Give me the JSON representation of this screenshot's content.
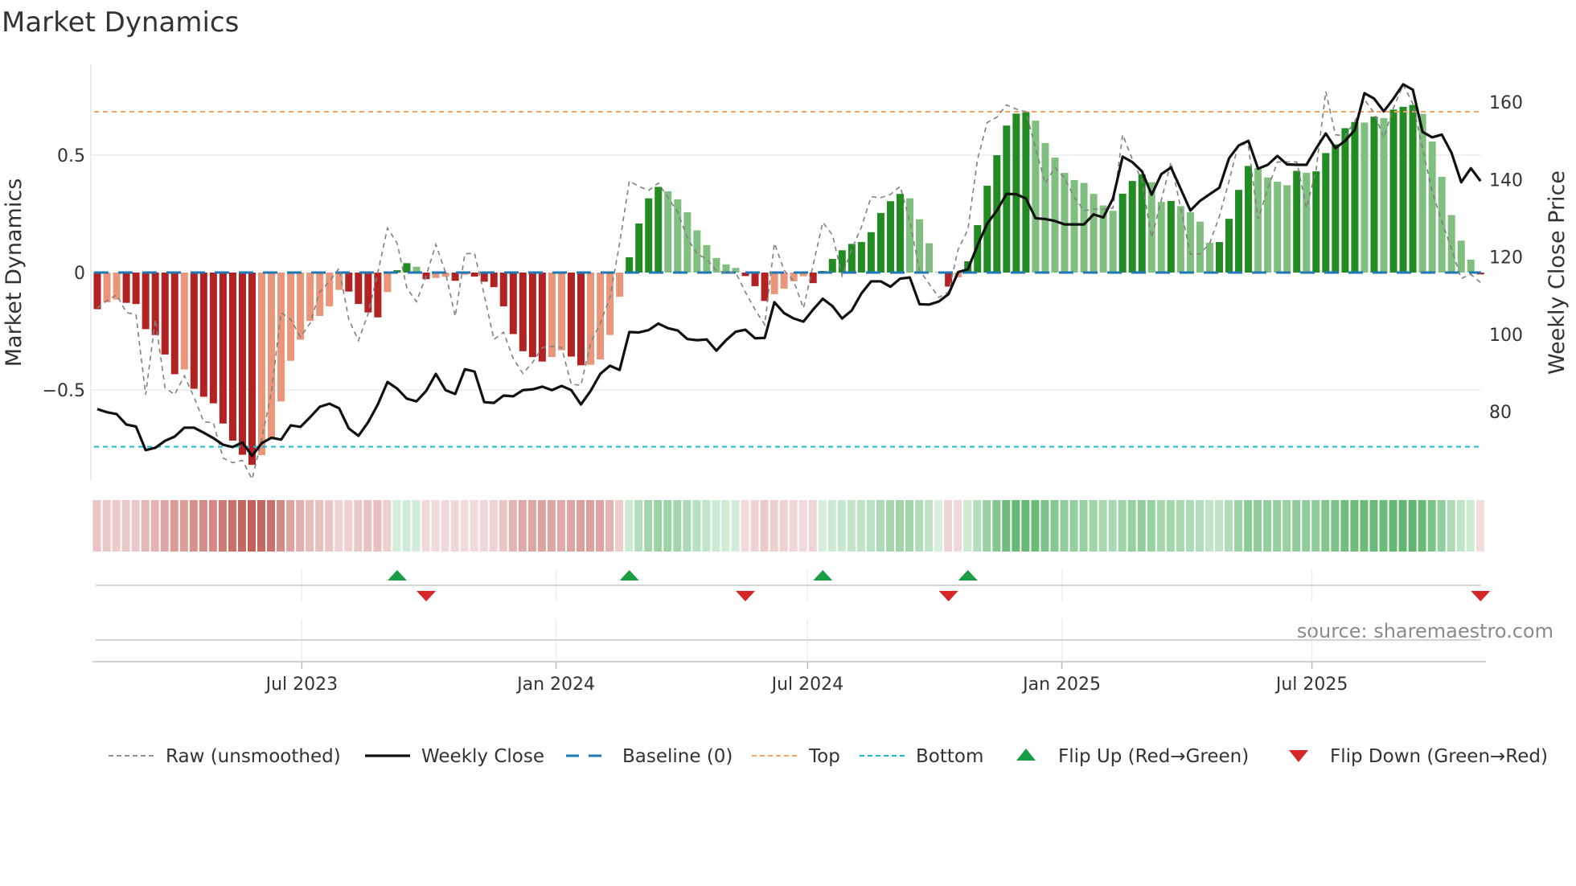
{
  "chart_data": {
    "type": "bar",
    "title": "Market Dynamics",
    "ylabel": "Market Dynamics",
    "y2label": "Weekly Close Price",
    "ylim": [
      -0.88,
      0.88
    ],
    "y2lim": [
      63,
      169
    ],
    "yticks": [
      {
        "v": 0.5,
        "label": "0.5"
      },
      {
        "v": 0,
        "label": "0"
      },
      {
        "v": -0.5,
        "label": "−0.5"
      }
    ],
    "y2ticks": [
      {
        "v": 160,
        "label": "160"
      },
      {
        "v": 140,
        "label": "140"
      },
      {
        "v": 120,
        "label": "120"
      },
      {
        "v": 100,
        "label": "100"
      },
      {
        "v": 80,
        "label": "80"
      }
    ],
    "xticks": [
      {
        "date": "2023-07-01",
        "label": "Jul 2023"
      },
      {
        "date": "2024-01-01",
        "label": "Jan 2024"
      },
      {
        "date": "2024-07-01",
        "label": "Jul 2024"
      },
      {
        "date": "2025-01-01",
        "label": "Jan 2025"
      },
      {
        "date": "2025-07-01",
        "label": "Jul 2025"
      }
    ],
    "first_week": "2023-02-03",
    "frequency": "weekly",
    "top_level": 0.685,
    "bottom_level": -0.742,
    "baseline": 0,
    "grid": true,
    "legend_position": "bottom",
    "series": [
      {
        "name": "Market Dynamics (smoothed)",
        "values": [
          -0.156,
          -0.127,
          -0.115,
          -0.129,
          -0.134,
          -0.241,
          -0.266,
          -0.349,
          -0.433,
          -0.413,
          -0.495,
          -0.529,
          -0.557,
          -0.643,
          -0.716,
          -0.776,
          -0.819,
          -0.778,
          -0.707,
          -0.549,
          -0.376,
          -0.286,
          -0.206,
          -0.185,
          -0.144,
          -0.074,
          -0.081,
          -0.134,
          -0.17,
          -0.191,
          -0.083,
          0.01,
          0.04,
          0.025,
          -0.028,
          -0.023,
          -0.018,
          -0.035,
          -0.009,
          -0.017,
          -0.039,
          -0.062,
          -0.144,
          -0.262,
          -0.335,
          -0.36,
          -0.379,
          -0.36,
          -0.331,
          -0.358,
          -0.395,
          -0.393,
          -0.37,
          -0.266,
          -0.103,
          0.065,
          0.209,
          0.316,
          0.365,
          0.346,
          0.312,
          0.257,
          0.18,
          0.117,
          0.062,
          0.035,
          0.02,
          -0.015,
          -0.058,
          -0.121,
          -0.092,
          -0.069,
          -0.037,
          -0.016,
          -0.045,
          0.007,
          0.058,
          0.095,
          0.122,
          0.13,
          0.172,
          0.254,
          0.304,
          0.335,
          0.316,
          0.227,
          0.125,
          0.003,
          -0.06,
          -0.02,
          0.048,
          0.202,
          0.37,
          0.5,
          0.626,
          0.677,
          0.684,
          0.647,
          0.552,
          0.49,
          0.425,
          0.394,
          0.382,
          0.335,
          0.286,
          0.263,
          0.336,
          0.39,
          0.419,
          0.385,
          0.301,
          0.305,
          0.283,
          0.257,
          0.217,
          0.127,
          0.13,
          0.229,
          0.352,
          0.454,
          0.445,
          0.405,
          0.387,
          0.372,
          0.433,
          0.425,
          0.431,
          0.509,
          0.546,
          0.615,
          0.641,
          0.639,
          0.664,
          0.658,
          0.694,
          0.706,
          0.714,
          0.676,
          0.558,
          0.408,
          0.245,
          0.136,
          0.055,
          -0.008
        ]
      },
      {
        "name": "Raw (unsmoothed)",
        "values": [
          -0.15,
          -0.12,
          -0.095,
          -0.17,
          -0.18,
          -0.52,
          -0.2,
          -0.49,
          -0.52,
          -0.44,
          -0.53,
          -0.635,
          -0.64,
          -0.79,
          -0.81,
          -0.8,
          -0.88,
          -0.71,
          -0.51,
          -0.17,
          -0.2,
          -0.274,
          -0.216,
          -0.083,
          -0.037,
          0.018,
          -0.2,
          -0.29,
          -0.175,
          0.0,
          0.19,
          0.125,
          -0.066,
          -0.124,
          -0.014,
          0.12,
          0.0,
          -0.187,
          0.08,
          0.082,
          -0.095,
          -0.285,
          -0.254,
          -0.366,
          -0.43,
          -0.383,
          -0.32,
          -0.314,
          -0.32,
          -0.476,
          -0.48,
          -0.3,
          -0.216,
          -0.106,
          0.125,
          0.39,
          0.367,
          0.35,
          0.381,
          0.32,
          0.257,
          0.148,
          0.079,
          0.058,
          0.009,
          0.0,
          0.0,
          -0.083,
          -0.158,
          -0.222,
          0.125,
          0.01,
          -0.037,
          -0.152,
          0.032,
          0.214,
          0.16,
          -0.014,
          0.1,
          0.194,
          0.323,
          0.319,
          0.333,
          0.367,
          0.217,
          0.01,
          -0.048,
          -0.106,
          -0.083,
          0.1,
          0.182,
          0.483,
          0.639,
          0.662,
          0.714,
          0.696,
          0.685,
          0.529,
          0.379,
          0.448,
          0.402,
          0.321,
          0.263,
          0.27,
          0.27,
          0.275,
          0.587,
          0.483,
          0.39,
          0.148,
          0.309,
          0.471,
          0.275,
          0.079,
          0.079,
          0.125,
          0.24,
          0.39,
          0.552,
          0.54,
          0.228,
          0.356,
          0.471,
          0.471,
          0.471,
          0.275,
          0.437,
          0.771,
          0.587,
          0.582,
          0.644,
          0.737,
          0.679,
          0.575,
          0.702,
          0.8,
          0.72,
          0.529,
          0.344,
          0.217,
          0.1,
          -0.025,
          -0.008,
          -0.043
        ]
      },
      {
        "name": "Weekly Close",
        "axis": "right",
        "values": [
          80.7,
          79.9,
          79.4,
          76.7,
          76.2,
          70.1,
          70.7,
          72.5,
          73.6,
          75.9,
          75.9,
          74.6,
          73.2,
          71.5,
          70.9,
          72.1,
          68.6,
          71.9,
          73.3,
          72.8,
          76.5,
          76.1,
          78.6,
          81.3,
          82.1,
          80.9,
          75.7,
          73.8,
          77.3,
          81.9,
          87.7,
          86.0,
          83.4,
          82.7,
          85.4,
          89.8,
          85.6,
          84.6,
          91.0,
          90.4,
          82.5,
          82.3,
          84.2,
          84.0,
          85.6,
          85.8,
          86.5,
          85.6,
          86.7,
          85.6,
          81.9,
          85.4,
          89.8,
          91.9,
          90.8,
          100.6,
          100.5,
          101.1,
          102.8,
          101.6,
          101.0,
          98.8,
          98.5,
          98.7,
          95.8,
          98.5,
          100.7,
          101.2,
          99.0,
          99.1,
          108.3,
          105.5,
          104.1,
          103.3,
          106.4,
          109.2,
          107.3,
          104.1,
          106.2,
          110.6,
          113.7,
          113.7,
          112.3,
          114.4,
          114.7,
          107.8,
          107.7,
          108.5,
          110.4,
          116.1,
          116.8,
          123.0,
          128.6,
          132.0,
          136.3,
          136.2,
          135.1,
          130.0,
          129.8,
          129.3,
          128.4,
          128.4,
          128.4,
          131.0,
          130.2,
          135.1,
          145.9,
          144.5,
          142.1,
          136.1,
          141.4,
          143.1,
          137.6,
          132.0,
          134.5,
          136.2,
          137.9,
          145.5,
          148.8,
          150.0,
          142.8,
          143.8,
          146.1,
          143.9,
          143.8,
          143.8,
          148.0,
          151.9,
          148.1,
          150.0,
          152.8,
          162.3,
          160.9,
          157.6,
          160.9,
          164.6,
          163.2,
          152.3,
          150.9,
          151.6,
          146.9,
          139.3,
          142.9,
          139.6
        ]
      }
    ],
    "flip_up_dates": [
      "2023-09-08",
      "2024-02-23",
      "2024-07-12",
      "2024-10-25"
    ],
    "flip_down_dates": [
      "2023-09-29",
      "2024-05-17",
      "2024-10-11",
      "2025-10-31"
    ],
    "colors": {
      "up_strong": "#228b22",
      "up_weak": "#80bf80",
      "down_strong": "#b22222",
      "down_weak": "#e9967a",
      "raw": "#808080",
      "close": "#111111",
      "baseline": "#1f77b4",
      "top": "#f4a460",
      "bottom": "#17becf",
      "flip_up": "#1a9e45",
      "flip_down": "#d62728",
      "strip_green_light": "#d6eedb",
      "strip_green_dark": "#4fae5f",
      "strip_red_light": "#f2dcdc",
      "strip_red_dark": "#c4605a"
    },
    "legend": [
      {
        "label": "Raw (unsmoothed)",
        "kind": "raw"
      },
      {
        "label": "Weekly Close",
        "kind": "close"
      },
      {
        "label": "Baseline (0)",
        "kind": "baseline"
      },
      {
        "label": "Top",
        "kind": "top"
      },
      {
        "label": "Bottom",
        "kind": "bottom"
      },
      {
        "label": "Flip Up (Red→Green)",
        "kind": "flip_up"
      },
      {
        "label": "Flip Down (Green→Red)",
        "kind": "flip_down"
      }
    ],
    "source": "source: sharemaestro.com"
  }
}
